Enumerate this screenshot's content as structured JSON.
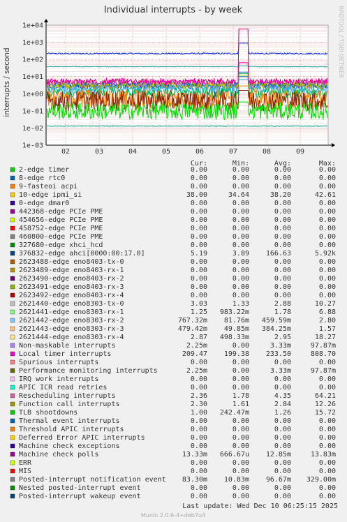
{
  "chart_data": {
    "type": "line",
    "title": "Individual interrupts - by week",
    "ylabel": "interrupts / second",
    "watermark": "RRDTOOL / TOBI OETIKER",
    "y_scale": "log",
    "ylim": [
      0.001,
      10000
    ],
    "yticks": [
      "1e-03",
      "1e-02",
      "1e-01",
      "1e+00",
      "1e+01",
      "1e+02",
      "1e+03",
      "1e+04"
    ],
    "categories": [
      "02",
      "03",
      "04",
      "05",
      "06",
      "07",
      "08",
      "09"
    ],
    "grid": true,
    "legend_position": "below",
    "columns": {
      "cur": "Cur:",
      "min": "Min:",
      "avg": "Avg:",
      "max": "Max:"
    },
    "series": [
      {
        "name": "2-edge      timer",
        "color": "#00cc00",
        "cur": "0.00",
        "min": "0.00",
        "avg": "0.00",
        "max": "0.00"
      },
      {
        "name": "8-edge      rtc0",
        "color": "#0066b3",
        "cur": "0.00",
        "min": "0.00",
        "avg": "0.00",
        "max": "0.00"
      },
      {
        "name": "9-fasteoi   acpi",
        "color": "#ff8000",
        "cur": "0.00",
        "min": "0.00",
        "avg": "0.00",
        "max": "0.00"
      },
      {
        "name": "10-edge      ipmi_si",
        "color": "#ffcc00",
        "cur": "38.00",
        "min": "34.64",
        "avg": "38.20",
        "max": "42.61"
      },
      {
        "name": "0-edge      dmar0",
        "color": "#330099",
        "cur": "0.00",
        "min": "0.00",
        "avg": "0.00",
        "max": "0.00"
      },
      {
        "name": "442368-edge      PCIe PME",
        "color": "#990099",
        "cur": "0.00",
        "min": "0.00",
        "avg": "0.00",
        "max": "0.00"
      },
      {
        "name": "454656-edge      PCIe PME",
        "color": "#ccff00",
        "cur": "0.00",
        "min": "0.00",
        "avg": "0.00",
        "max": "0.00"
      },
      {
        "name": "458752-edge      PCIe PME",
        "color": "#ff0000",
        "cur": "0.00",
        "min": "0.00",
        "avg": "0.00",
        "max": "0.00"
      },
      {
        "name": "460800-edge      PCIe PME",
        "color": "#808080",
        "cur": "0.00",
        "min": "0.00",
        "avg": "0.00",
        "max": "0.00"
      },
      {
        "name": "327680-edge      xhci_hcd",
        "color": "#008f00",
        "cur": "0.00",
        "min": "0.00",
        "avg": "0.00",
        "max": "0.00"
      },
      {
        "name": "376832-edge      ahci[0000:00:17.0]",
        "color": "#00487d",
        "cur": "5.19",
        "min": "3.89",
        "avg": "166.63",
        "max": "5.92k"
      },
      {
        "name": "2623488-edge      eno8403-tx-0",
        "color": "#b35a00",
        "cur": "0.00",
        "min": "0.00",
        "avg": "0.00",
        "max": "0.00"
      },
      {
        "name": "2623489-edge      eno8403-rx-1",
        "color": "#b38f00",
        "cur": "0.00",
        "min": "0.00",
        "avg": "0.00",
        "max": "0.00"
      },
      {
        "name": "2623490-edge      eno8403-rx-2",
        "color": "#6b006b",
        "cur": "0.00",
        "min": "0.00",
        "avg": "0.00",
        "max": "0.00"
      },
      {
        "name": "2623491-edge      eno8403-rx-3",
        "color": "#8fb300",
        "cur": "0.00",
        "min": "0.00",
        "avg": "0.00",
        "max": "0.00"
      },
      {
        "name": "2623492-edge      eno8403-rx-4",
        "color": "#b30000",
        "cur": "0.00",
        "min": "0.00",
        "avg": "0.00",
        "max": "0.00"
      },
      {
        "name": "2621440-edge      eno8303-tx-0",
        "color": "#bebebe",
        "cur": "3.03",
        "min": "1.33",
        "avg": "2.88",
        "max": "10.27"
      },
      {
        "name": "2621441-edge      eno8303-rx-1",
        "color": "#80ff80",
        "cur": "1.25",
        "min": "983.22m",
        "avg": "1.78",
        "max": "6.88"
      },
      {
        "name": "2621442-edge      eno8303-rx-2",
        "color": "#80c9ff",
        "cur": "767.32m",
        "min": "81.76m",
        "avg": "459.59m",
        "max": "2.80"
      },
      {
        "name": "2621443-edge      eno8303-rx-3",
        "color": "#ffc080",
        "cur": "479.42m",
        "min": "49.85m",
        "avg": "384.25m",
        "max": "1.57"
      },
      {
        "name": "2621444-edge      eno8303-rx-4",
        "color": "#ffe680",
        "cur": "2.87",
        "min": "498.33m",
        "avg": "2.95",
        "max": "18.27"
      },
      {
        "name": "Non-maskable interrupts",
        "color": "#aa80ff",
        "cur": "2.25m",
        "min": "0.00",
        "avg": "3.33m",
        "max": "97.87m"
      },
      {
        "name": "Local timer interrupts",
        "color": "#ee00cc",
        "cur": "209.47",
        "min": "199.38",
        "avg": "233.50",
        "max": "808.70"
      },
      {
        "name": "Spurious interrupts",
        "color": "#ff8080",
        "cur": "0.00",
        "min": "0.00",
        "avg": "0.00",
        "max": "0.00"
      },
      {
        "name": "Performance monitoring interrupts",
        "color": "#666600",
        "cur": "2.25m",
        "min": "0.00",
        "avg": "3.33m",
        "max": "97.87m"
      },
      {
        "name": "IRQ work interrupts",
        "color": "#ffbfff",
        "cur": "0.00",
        "min": "0.00",
        "avg": "0.00",
        "max": "0.00"
      },
      {
        "name": "APIC ICR read retries",
        "color": "#00ffcc",
        "cur": "0.00",
        "min": "0.00",
        "avg": "0.00",
        "max": "0.00"
      },
      {
        "name": "Rescheduling interrupts",
        "color": "#cc6699",
        "cur": "2.36",
        "min": "1.78",
        "avg": "4.35",
        "max": "64.21"
      },
      {
        "name": "Function call interrupts",
        "color": "#999900",
        "cur": "2.30",
        "min": "1.61",
        "avg": "2.84",
        "max": "12.26"
      },
      {
        "name": "TLB shootdowns",
        "color": "#00cc00",
        "cur": "1.00",
        "min": "242.47m",
        "avg": "1.26",
        "max": "15.72"
      },
      {
        "name": "Thermal event interrupts",
        "color": "#0066b3",
        "cur": "0.00",
        "min": "0.00",
        "avg": "0.00",
        "max": "0.00"
      },
      {
        "name": "Threshold APIC interrupts",
        "color": "#ff8000",
        "cur": "0.00",
        "min": "0.00",
        "avg": "0.00",
        "max": "0.00"
      },
      {
        "name": "Deferred Error APIC interrupts",
        "color": "#ffcc00",
        "cur": "0.00",
        "min": "0.00",
        "avg": "0.00",
        "max": "0.00"
      },
      {
        "name": "Machine check exceptions",
        "color": "#330099",
        "cur": "0.00",
        "min": "0.00",
        "avg": "0.00",
        "max": "0.00"
      },
      {
        "name": "Machine check polls",
        "color": "#990099",
        "cur": "13.33m",
        "min": "666.67u",
        "avg": "12.85m",
        "max": "13.83m"
      },
      {
        "name": "ERR",
        "color": "#ccff00",
        "cur": "0.00",
        "min": "0.00",
        "avg": "0.00",
        "max": "0.00"
      },
      {
        "name": "MIS",
        "color": "#ff0000",
        "cur": "0.00",
        "min": "0.00",
        "avg": "0.00",
        "max": "0.00"
      },
      {
        "name": "Posted-interrupt notification event",
        "color": "#808080",
        "cur": "83.30m",
        "min": "10.83m",
        "avg": "96.67m",
        "max": "329.00m"
      },
      {
        "name": "Nested posted-interrupt event",
        "color": "#008f00",
        "cur": "0.00",
        "min": "0.00",
        "avg": "0.00",
        "max": "0.00"
      },
      {
        "name": "Posted-interrupt wakeup event",
        "color": "#00487d",
        "cur": "0.00",
        "min": "0.00",
        "avg": "0.00",
        "max": "0.00"
      }
    ],
    "plotted_lines": [
      {
        "label": "Local timer interrupts",
        "color": "#0022ee",
        "base": 220,
        "noise": 0.04,
        "spike": 900
      },
      {
        "label": "10-edge ipmi_si",
        "color": "#20a0a0",
        "base": 38,
        "noise": 0.02,
        "spike": 42
      },
      {
        "label": "376832-edge ahci[0000:00:17.0]",
        "color": "#cc0066",
        "base": 5,
        "noise": 0.15,
        "spike": 5900
      },
      {
        "label": "Rescheduling interrupts",
        "color": "#ee00aa",
        "base": 4,
        "noise": 0.3,
        "spike": 64
      },
      {
        "label": "2621444-edge eno8303-rx-4",
        "color": "#3366cc",
        "base": 2.9,
        "noise": 0.2,
        "spike": 18
      },
      {
        "label": "2621440-edge eno8303-tx-0",
        "color": "#1166aa",
        "base": 2.9,
        "noise": 0.15,
        "spike": 10
      },
      {
        "label": "Function call interrupts",
        "color": "#bbbb00",
        "base": 2.8,
        "noise": 0.2,
        "spike": 12
      },
      {
        "label": "2621441-edge eno8303-rx-1",
        "color": "#44aaee",
        "base": 1.8,
        "noise": 0.25,
        "spike": 6.9
      },
      {
        "label": "TLB shootdowns",
        "color": "#00bb55",
        "base": 1.1,
        "noise": 0.3,
        "spike": 15
      },
      {
        "label": "2621442-edge eno8303-rx-2",
        "color": "#ff8800",
        "base": 0.46,
        "noise": 0.6,
        "spike": 2.8
      },
      {
        "label": "2621443-edge eno8303-rx-3",
        "color": "#882200",
        "base": 0.38,
        "noise": 0.6,
        "spike": 1.57
      },
      {
        "label": "Posted-interrupt notification event",
        "color": "#00dd00",
        "base": 0.097,
        "noise": 0.5,
        "spike": 0.33
      },
      {
        "label": "Machine check polls",
        "color": "#009977",
        "base": 0.013,
        "noise": 0.02,
        "spike": 0.013
      }
    ],
    "footer": {
      "last_update": "Last update:  Wed Dec 10 06:25:15 2025",
      "version": "Munin 2.0.6-4+deb7u4"
    }
  }
}
